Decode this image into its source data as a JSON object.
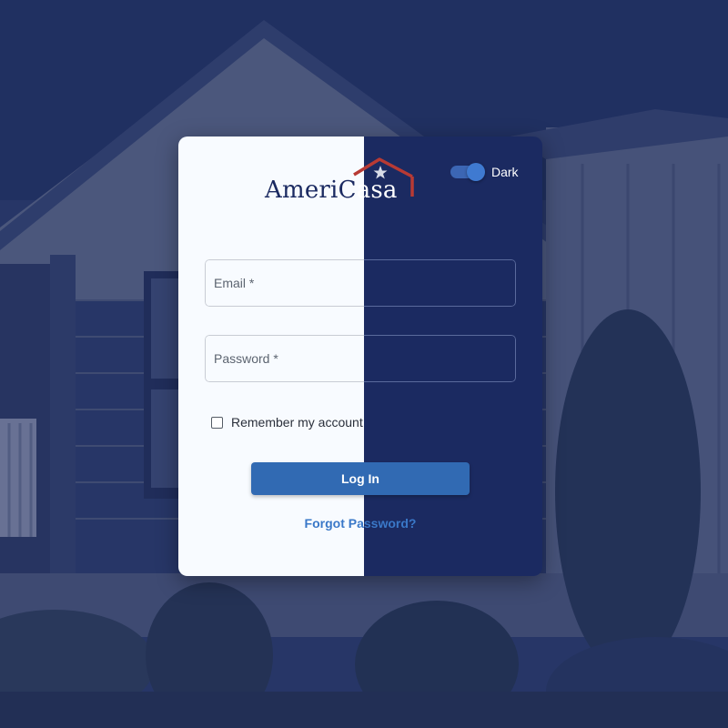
{
  "brand": {
    "name_part1": "Ameri",
    "name_part2": "Casa",
    "roof_color": "#b83a34",
    "navy": "#1b2a61"
  },
  "theme_toggle": {
    "label": "Dark",
    "checked": true
  },
  "form": {
    "email": {
      "placeholder": "Email *",
      "value": ""
    },
    "password": {
      "placeholder": "Password *",
      "value": ""
    },
    "remember_label": "Remember my account",
    "remember_checked": false,
    "login_label": "Log In",
    "forgot_label": "Forgot Password?"
  },
  "colors": {
    "card_light": "#f8fbff",
    "card_dark": "#1b2a61",
    "button": "#316ab3",
    "link": "#3a78c8"
  }
}
